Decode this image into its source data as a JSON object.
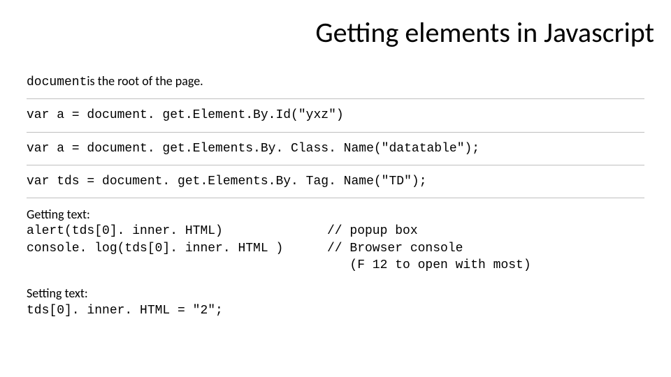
{
  "title": "Getting elements in Javascript",
  "intro": {
    "code": "document",
    "text": " is the root of the page."
  },
  "line1": "var a = document. get.Element.By.Id(\"yxz\")",
  "line2": "var a = document. get.Elements.By. Class. Name(\"datatable\");",
  "line3": "var tds = document. get.Elements.By. Tag. Name(\"TD\");",
  "getting": {
    "heading": "Getting text:",
    "l1_left": "alert(tds[0]. inner. HTML)",
    "l1_right": "// popup box",
    "l2_left": "console. log(tds[0]. inner. HTML )",
    "l2_right": "// Browser console",
    "l3_right": "   (F 12 to open with most)"
  },
  "setting": {
    "heading": "Setting text:",
    "line": "tds[0]. inner. HTML = \"2\";"
  }
}
